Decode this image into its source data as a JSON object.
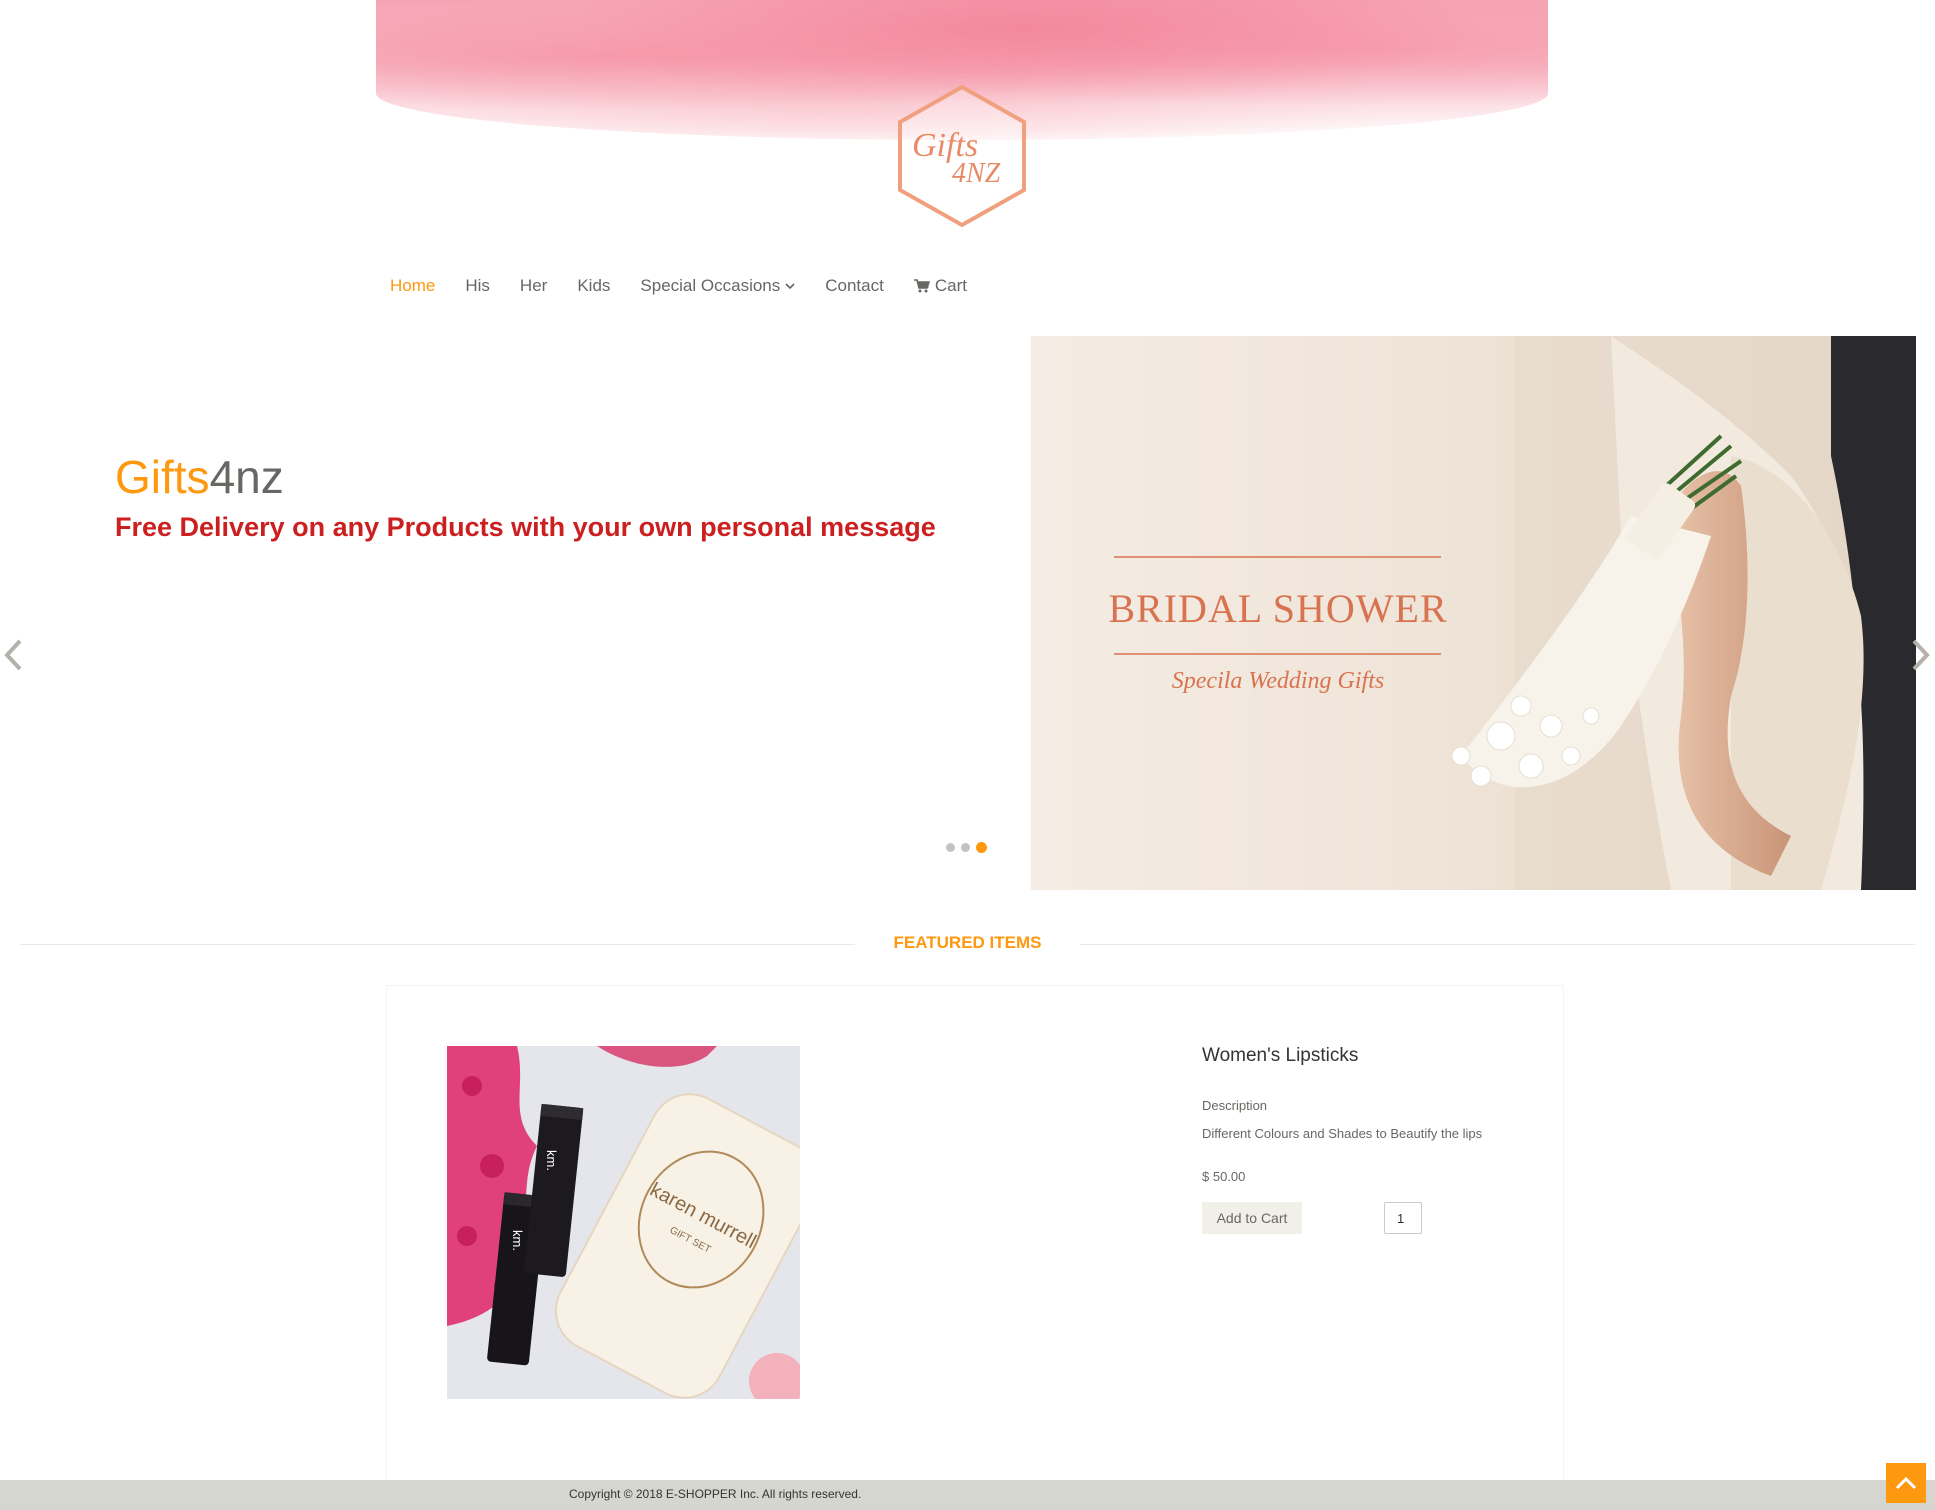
{
  "brand": {
    "logo_text_main": "Gifts",
    "logo_text_sub": "4NZ",
    "title_part1": "Gifts",
    "title_part2": "4nz"
  },
  "nav": {
    "items": [
      {
        "label": "Home",
        "active": true
      },
      {
        "label": "His"
      },
      {
        "label": "Her"
      },
      {
        "label": "Kids"
      },
      {
        "label": "Special Occasions",
        "has_dropdown": true
      },
      {
        "label": "Contact"
      },
      {
        "label": "Cart",
        "icon": "cart-icon"
      }
    ]
  },
  "slider": {
    "tagline": "Free Delivery on any Products with your own personal message",
    "image_title": "BRIDAL SHOWER",
    "image_subtitle": "Specila Wedding Gifts",
    "active_slide": 3,
    "slide_count": 3
  },
  "featured": {
    "heading": "FEATURED ITEMS",
    "product": {
      "name": "Women's Lipsticks",
      "description_label": "Description",
      "description": "Different Colours and Shades to Beautify the lips",
      "price": "$ 50.00",
      "add_to_cart_label": "Add to Cart",
      "quantity": "1",
      "packaging_text": "karen murrell",
      "packaging_sub": "GIFT SET",
      "lipstick_label": "km."
    }
  },
  "footer": {
    "copyright": "Copyright © 2018 E-SHOPPER Inc. All rights reserved."
  },
  "colors": {
    "accent": "#fe980f",
    "tagline": "#cc1f1f",
    "text": "#696763",
    "footer_bg": "#d6d6d0"
  }
}
